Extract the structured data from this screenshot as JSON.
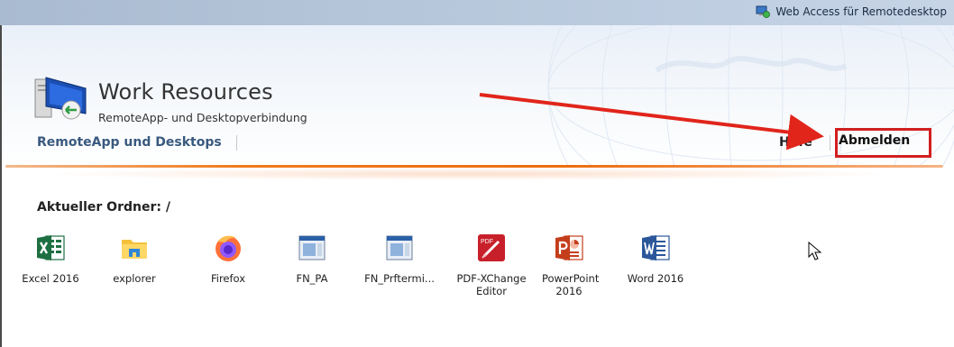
{
  "topbar": {
    "service_label": "Web Access für Remotedesktop"
  },
  "header": {
    "title": "Work Resources",
    "subtitle": "RemoteApp- und Desktopverbindung"
  },
  "nav": {
    "remoteapp": "RemoteApp und Desktops",
    "help": "Hilfe",
    "logout": "Abmelden"
  },
  "folder": {
    "label": "Aktueller Ordner: /"
  },
  "apps": [
    {
      "label": "Excel 2016",
      "icon": "excel-icon"
    },
    {
      "label": "explorer",
      "icon": "folder-icon"
    },
    {
      "label": "Firefox",
      "icon": "firefox-icon"
    },
    {
      "label": "FN_PA",
      "icon": "window-icon"
    },
    {
      "label": "FN_Prftermi...",
      "icon": "window-icon"
    },
    {
      "label": "PDF-XChange Editor",
      "icon": "pdf-icon"
    },
    {
      "label": "PowerPoint 2016",
      "icon": "powerpoint-icon"
    },
    {
      "label": "Word 2016",
      "icon": "word-icon"
    }
  ],
  "pdf_badge": "PDF",
  "colors": {
    "accent_orange": "#f07a1a",
    "highlight_red": "#d21f1f",
    "nav_blue": "#39597e"
  }
}
